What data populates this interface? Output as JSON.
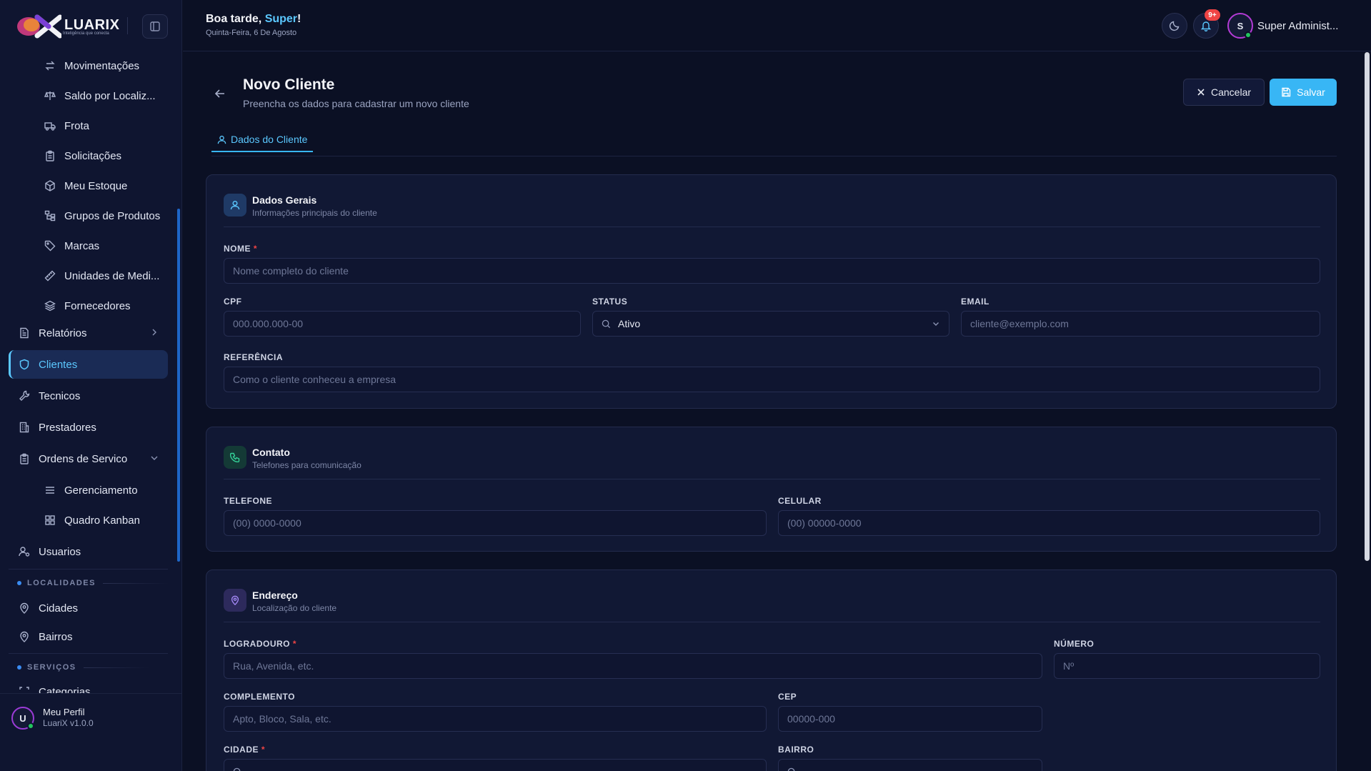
{
  "brand": {
    "name": "LUARIX",
    "tagline": "Inteligência que conecta"
  },
  "header": {
    "greeting_prefix": "Boa tarde, ",
    "greeting_name": "Super",
    "greeting_suffix": "!",
    "date": "Quinta-Feira, 6 De Agosto",
    "notifications_badge": "9+",
    "user_initial": "S",
    "user_name": "Super Administ..."
  },
  "sidebar": {
    "items": [
      {
        "label": "Movimentações",
        "icon": "arrows-swap-icon"
      },
      {
        "label": "Saldo por Localiz...",
        "icon": "scale-icon"
      },
      {
        "label": "Frota",
        "icon": "truck-icon"
      },
      {
        "label": "Solicitações",
        "icon": "clipboard-icon"
      },
      {
        "label": "Meu Estoque",
        "icon": "box-icon"
      },
      {
        "label": "Grupos de Produtos",
        "icon": "tree-icon"
      },
      {
        "label": "Marcas",
        "icon": "tag-icon"
      },
      {
        "label": "Unidades de Medi...",
        "icon": "ruler-icon"
      },
      {
        "label": "Fornecedores",
        "icon": "layers-icon"
      },
      {
        "label": "Relatórios",
        "icon": "report-icon"
      },
      {
        "label": "Clientes",
        "icon": "shield-icon"
      },
      {
        "label": "Tecnicos",
        "icon": "wrench-icon"
      },
      {
        "label": "Prestadores",
        "icon": "building-icon"
      },
      {
        "label": "Ordens de Servico",
        "icon": "clipboard-list-icon"
      },
      {
        "label": "Gerenciamento",
        "icon": "list-icon"
      },
      {
        "label": "Quadro Kanban",
        "icon": "kanban-icon"
      },
      {
        "label": "Usuarios",
        "icon": "user-cog-icon"
      },
      {
        "label": "Cidades",
        "icon": "map-pin-icon"
      },
      {
        "label": "Bairros",
        "icon": "map-pin-icon"
      },
      {
        "label": "Categorias",
        "icon": "scan-icon"
      }
    ],
    "sections": {
      "localidades": "LOCALIDADES",
      "servicos": "SERVIÇOS"
    },
    "profile": {
      "initial": "U",
      "name": "Meu Perfil",
      "version": "LuariX v1.0.0"
    }
  },
  "page": {
    "title": "Novo Cliente",
    "subtitle": "Preencha os dados para cadastrar um novo cliente",
    "cancel_label": "Cancelar",
    "save_label": "Salvar",
    "tab_label": "Dados do Cliente"
  },
  "general": {
    "title": "Dados Gerais",
    "subtitle": "Informações principais do cliente",
    "nome_label": "NOME",
    "nome_placeholder": "Nome completo do cliente",
    "cpf_label": "CPF",
    "cpf_placeholder": "000.000.000-00",
    "status_label": "STATUS",
    "status_value": "Ativo",
    "email_label": "EMAIL",
    "email_placeholder": "cliente@exemplo.com",
    "ref_label": "REFERÊNCIA",
    "ref_placeholder": "Como o cliente conheceu a empresa"
  },
  "contact": {
    "title": "Contato",
    "subtitle": "Telefones para comunicação",
    "phone_label": "TELEFONE",
    "phone_placeholder": "(00) 0000-0000",
    "mobile_label": "CELULAR",
    "mobile_placeholder": "(00) 00000-0000"
  },
  "address": {
    "title": "Endereço",
    "subtitle": "Localização do cliente",
    "street_label": "LOGRADOURO",
    "street_placeholder": "Rua, Avenida, etc.",
    "number_label": "NÚMERO",
    "number_placeholder": "Nº",
    "complement_label": "COMPLEMENTO",
    "complement_placeholder": "Apto, Bloco, Sala, etc.",
    "cep_label": "CEP",
    "cep_placeholder": "00000-000",
    "city_label": "CIDADE",
    "district_label": "BAIRRO"
  },
  "required_mark": "*",
  "colors": {
    "accent": "#38b6f5",
    "background": "#0b1024",
    "danger": "#ef4444",
    "online": "#22c55e"
  }
}
